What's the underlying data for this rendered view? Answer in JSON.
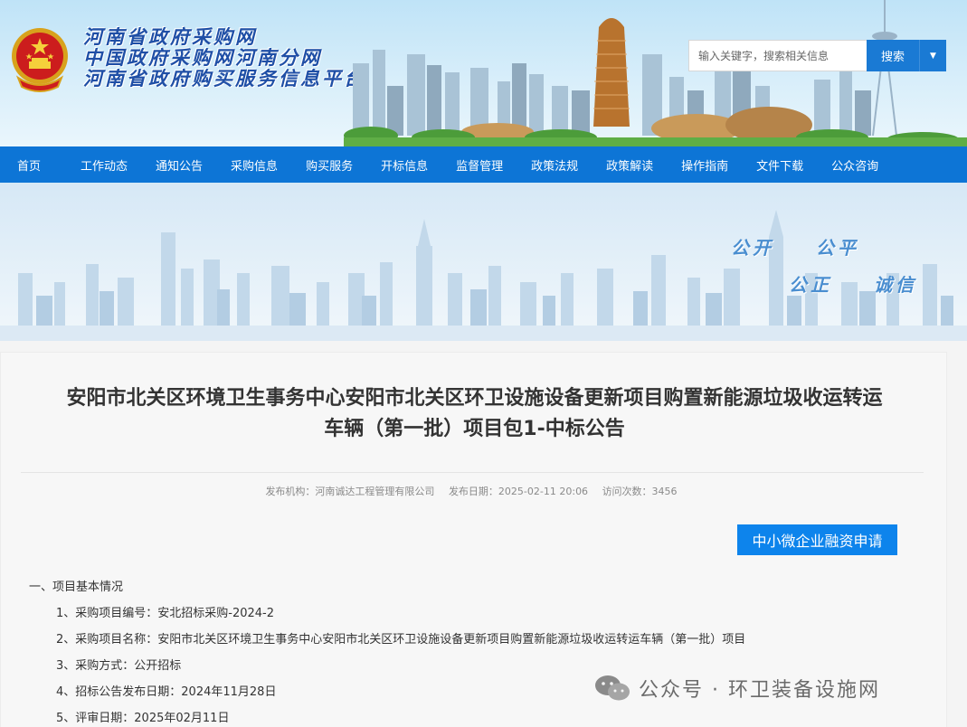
{
  "header": {
    "titles": [
      "河南省政府采购网",
      "中国政府采购网河南分网",
      "河南省政府购买服务信息平台"
    ],
    "search": {
      "placeholder": "输入关键字，搜索相关信息",
      "button_label": "搜索"
    }
  },
  "nav": {
    "items": [
      "首页",
      "工作动态",
      "通知公告",
      "采购信息",
      "购买服务",
      "开标信息",
      "监督管理",
      "政策法规",
      "政策解读",
      "操作指南",
      "文件下载",
      "公众咨询"
    ]
  },
  "banner": {
    "slogans": [
      "公开",
      "公平",
      "公正",
      "诚信"
    ]
  },
  "article": {
    "title_line1": "安阳市北关区环境卫生事务中心安阳市北关区环卫设施设备更新项目购置新能源垃圾收运转运",
    "title_line2": "车辆（第一批）项目包1-中标公告",
    "publisher": "发布机构：河南诚达工程管理有限公司",
    "date": "发布日期：2025-02-11 20:06",
    "visits": "访问次数：3456",
    "finance_button": "中小微企业融资申请",
    "section1": "一、项目基本情况",
    "items": [
      "1、采购项目编号：安北招标采购-2024-2",
      "2、采购项目名称：安阳市北关区环境卫生事务中心安阳市北关区环卫设施设备更新项目购置新能源垃圾收运转运车辆（第一批）项目",
      "3、采购方式：公开招标",
      "4、招标公告发布日期：2024年11月28日",
      "5、评审日期：2025年02月11日"
    ]
  },
  "watermark": {
    "text": "公众号 · 环卫装备设施网"
  },
  "colors": {
    "nav_bg": "#0d75d6",
    "accent": "#1a7ad4",
    "title_blue": "#1f4fa6",
    "finance_btn": "#0d84ec"
  }
}
